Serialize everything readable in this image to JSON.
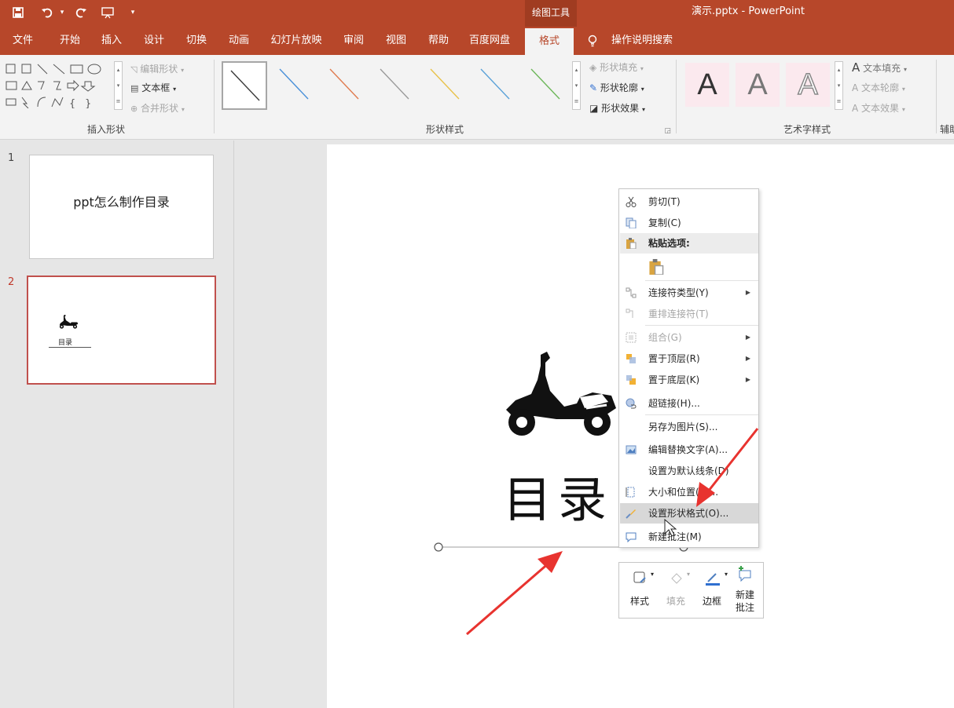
{
  "window": {
    "doc_title": "演示.pptx  -  PowerPoint",
    "context_tool_label": "绘图工具",
    "accent_color": "#b7472a"
  },
  "quick_access": {
    "save_icon": "save-icon",
    "undo_icon": "undo-icon",
    "redo_icon": "redo-icon",
    "present_icon": "present-icon",
    "customize_icon": "dropdown-icon"
  },
  "tabs": [
    "文件",
    "开始",
    "插入",
    "设计",
    "切换",
    "动画",
    "幻灯片放映",
    "审阅",
    "视图",
    "帮助",
    "百度网盘",
    "格式"
  ],
  "active_tab": "格式",
  "tell_me": "操作说明搜索",
  "ribbon": {
    "insert_shapes": {
      "label": "插入形状",
      "edit_shape": "编辑形状",
      "text_box": "文本框",
      "merge_shapes": "合并形状"
    },
    "shape_styles": {
      "label": "形状样式",
      "fill": "形状填充",
      "outline": "形状轮廓",
      "effects": "形状效果",
      "line_colors": [
        "#3a3a3a",
        "#4a90d9",
        "#e07b4f",
        "#9a9a9a",
        "#e8c24a",
        "#5aa1d8",
        "#6db75a"
      ]
    },
    "wordart": {
      "label": "艺术字样式",
      "text_fill": "文本填充",
      "text_outline": "文本轮廓",
      "text_effects": "文本效果",
      "letters": [
        "A",
        "A",
        "A"
      ]
    },
    "partial_group_label": "辅助"
  },
  "slides": [
    {
      "number": "1",
      "title": "ppt怎么制作目录"
    },
    {
      "number": "2",
      "title": "目录"
    }
  ],
  "current_slide": {
    "title": "目录",
    "image_icon": "scooter-icon"
  },
  "context_menu": {
    "items": [
      {
        "label": "剪切(T)",
        "icon": "cut-icon"
      },
      {
        "label": "复制(C)",
        "icon": "copy-icon"
      },
      {
        "label": "粘贴选项:",
        "icon": "paste-icon"
      },
      {
        "label": "",
        "icon": "paste-option-icon"
      },
      {
        "label": "连接符类型(Y)",
        "icon": "connector-icon"
      },
      {
        "label": "重排连接符(T)",
        "icon": "reroute-icon"
      },
      {
        "label": "组合(G)",
        "icon": "group-icon"
      },
      {
        "label": "置于顶层(R)",
        "icon": "bring-front-icon"
      },
      {
        "label": "置于底层(K)",
        "icon": "send-back-icon"
      },
      {
        "label": "超链接(H)...",
        "icon": "hyperlink-icon"
      },
      {
        "label": "另存为图片(S)...",
        "icon": ""
      },
      {
        "label": "编辑替换文字(A)...",
        "icon": "alt-text-icon"
      },
      {
        "label": "设置为默认线条(D)",
        "icon": ""
      },
      {
        "label": "大小和位置(Z)...",
        "icon": "size-position-icon"
      },
      {
        "label": "设置形状格式(O)...",
        "icon": "format-shape-icon"
      },
      {
        "label": "新建批注(M)",
        "icon": "comment-icon"
      }
    ]
  },
  "mini_toolbar": {
    "style": "样式",
    "fill": "填充",
    "outline": "边框",
    "new_comment_1": "新建",
    "new_comment_2": "批注"
  },
  "annotation_color": "#e8332f"
}
